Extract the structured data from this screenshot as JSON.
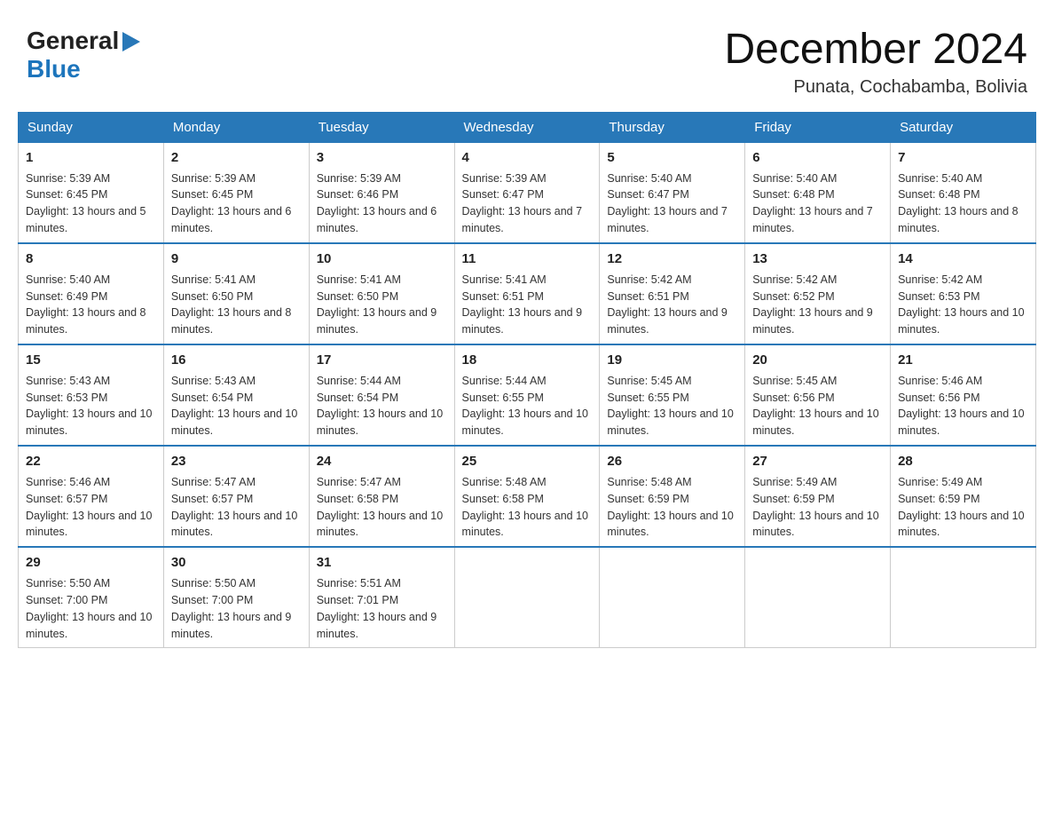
{
  "header": {
    "logo_general": "General",
    "logo_blue": "Blue",
    "month_title": "December 2024",
    "location": "Punata, Cochabamba, Bolivia"
  },
  "days_of_week": [
    "Sunday",
    "Monday",
    "Tuesday",
    "Wednesday",
    "Thursday",
    "Friday",
    "Saturday"
  ],
  "weeks": [
    [
      {
        "num": "1",
        "sunrise": "5:39 AM",
        "sunset": "6:45 PM",
        "daylight": "13 hours and 5 minutes."
      },
      {
        "num": "2",
        "sunrise": "5:39 AM",
        "sunset": "6:45 PM",
        "daylight": "13 hours and 6 minutes."
      },
      {
        "num": "3",
        "sunrise": "5:39 AM",
        "sunset": "6:46 PM",
        "daylight": "13 hours and 6 minutes."
      },
      {
        "num": "4",
        "sunrise": "5:39 AM",
        "sunset": "6:47 PM",
        "daylight": "13 hours and 7 minutes."
      },
      {
        "num": "5",
        "sunrise": "5:40 AM",
        "sunset": "6:47 PM",
        "daylight": "13 hours and 7 minutes."
      },
      {
        "num": "6",
        "sunrise": "5:40 AM",
        "sunset": "6:48 PM",
        "daylight": "13 hours and 7 minutes."
      },
      {
        "num": "7",
        "sunrise": "5:40 AM",
        "sunset": "6:48 PM",
        "daylight": "13 hours and 8 minutes."
      }
    ],
    [
      {
        "num": "8",
        "sunrise": "5:40 AM",
        "sunset": "6:49 PM",
        "daylight": "13 hours and 8 minutes."
      },
      {
        "num": "9",
        "sunrise": "5:41 AM",
        "sunset": "6:50 PM",
        "daylight": "13 hours and 8 minutes."
      },
      {
        "num": "10",
        "sunrise": "5:41 AM",
        "sunset": "6:50 PM",
        "daylight": "13 hours and 9 minutes."
      },
      {
        "num": "11",
        "sunrise": "5:41 AM",
        "sunset": "6:51 PM",
        "daylight": "13 hours and 9 minutes."
      },
      {
        "num": "12",
        "sunrise": "5:42 AM",
        "sunset": "6:51 PM",
        "daylight": "13 hours and 9 minutes."
      },
      {
        "num": "13",
        "sunrise": "5:42 AM",
        "sunset": "6:52 PM",
        "daylight": "13 hours and 9 minutes."
      },
      {
        "num": "14",
        "sunrise": "5:42 AM",
        "sunset": "6:53 PM",
        "daylight": "13 hours and 10 minutes."
      }
    ],
    [
      {
        "num": "15",
        "sunrise": "5:43 AM",
        "sunset": "6:53 PM",
        "daylight": "13 hours and 10 minutes."
      },
      {
        "num": "16",
        "sunrise": "5:43 AM",
        "sunset": "6:54 PM",
        "daylight": "13 hours and 10 minutes."
      },
      {
        "num": "17",
        "sunrise": "5:44 AM",
        "sunset": "6:54 PM",
        "daylight": "13 hours and 10 minutes."
      },
      {
        "num": "18",
        "sunrise": "5:44 AM",
        "sunset": "6:55 PM",
        "daylight": "13 hours and 10 minutes."
      },
      {
        "num": "19",
        "sunrise": "5:45 AM",
        "sunset": "6:55 PM",
        "daylight": "13 hours and 10 minutes."
      },
      {
        "num": "20",
        "sunrise": "5:45 AM",
        "sunset": "6:56 PM",
        "daylight": "13 hours and 10 minutes."
      },
      {
        "num": "21",
        "sunrise": "5:46 AM",
        "sunset": "6:56 PM",
        "daylight": "13 hours and 10 minutes."
      }
    ],
    [
      {
        "num": "22",
        "sunrise": "5:46 AM",
        "sunset": "6:57 PM",
        "daylight": "13 hours and 10 minutes."
      },
      {
        "num": "23",
        "sunrise": "5:47 AM",
        "sunset": "6:57 PM",
        "daylight": "13 hours and 10 minutes."
      },
      {
        "num": "24",
        "sunrise": "5:47 AM",
        "sunset": "6:58 PM",
        "daylight": "13 hours and 10 minutes."
      },
      {
        "num": "25",
        "sunrise": "5:48 AM",
        "sunset": "6:58 PM",
        "daylight": "13 hours and 10 minutes."
      },
      {
        "num": "26",
        "sunrise": "5:48 AM",
        "sunset": "6:59 PM",
        "daylight": "13 hours and 10 minutes."
      },
      {
        "num": "27",
        "sunrise": "5:49 AM",
        "sunset": "6:59 PM",
        "daylight": "13 hours and 10 minutes."
      },
      {
        "num": "28",
        "sunrise": "5:49 AM",
        "sunset": "6:59 PM",
        "daylight": "13 hours and 10 minutes."
      }
    ],
    [
      {
        "num": "29",
        "sunrise": "5:50 AM",
        "sunset": "7:00 PM",
        "daylight": "13 hours and 10 minutes."
      },
      {
        "num": "30",
        "sunrise": "5:50 AM",
        "sunset": "7:00 PM",
        "daylight": "13 hours and 9 minutes."
      },
      {
        "num": "31",
        "sunrise": "5:51 AM",
        "sunset": "7:01 PM",
        "daylight": "13 hours and 9 minutes."
      },
      null,
      null,
      null,
      null
    ]
  ]
}
